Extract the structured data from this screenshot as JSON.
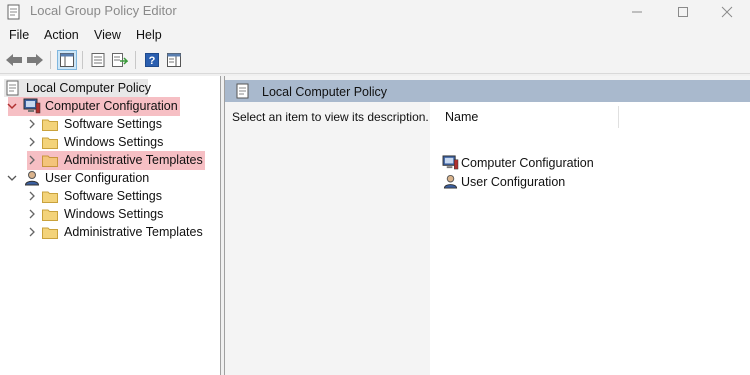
{
  "window": {
    "title": "Local Group Policy Editor",
    "minimize_glyph": "─",
    "maximize_glyph": "☐",
    "close_glyph": "✕"
  },
  "menu": [
    "File",
    "Action",
    "View",
    "Help"
  ],
  "toolbar": {
    "buttons": [
      "back-icon",
      "forward-icon",
      "show-hide-console-tree-icon",
      "properties-icon",
      "export-list-icon",
      "help-icon",
      "show-hide-action-pane-icon"
    ]
  },
  "tree": {
    "root": "Local Computer Policy",
    "computer_configuration": {
      "label": "Computer Configuration",
      "children": [
        "Software Settings",
        "Windows Settings",
        "Administrative Templates"
      ]
    },
    "user_configuration": {
      "label": "User Configuration",
      "children": [
        "Software Settings",
        "Windows Settings",
        "Administrative Templates"
      ]
    }
  },
  "details": {
    "header_title": "Local Computer Policy",
    "description": "Select an item to view its description.",
    "column_name": "Name",
    "items": [
      "Computer Configuration",
      "User Configuration"
    ]
  },
  "colors": {
    "highlight": "#f6bfc4",
    "header": "#a9b9cd",
    "folder": "#f3d37a"
  }
}
